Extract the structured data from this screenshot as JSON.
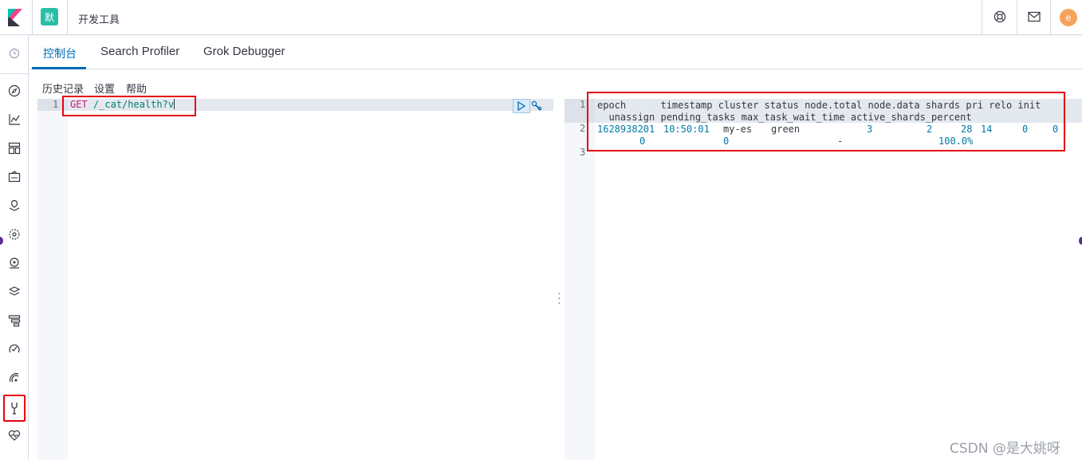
{
  "header": {
    "space_initial": "默",
    "breadcrumb": "开发工具",
    "user_initial": "e"
  },
  "tabs": [
    {
      "label": "控制台",
      "active": true
    },
    {
      "label": "Search Profiler",
      "active": false
    },
    {
      "label": "Grok Debugger",
      "active": false
    }
  ],
  "menu": {
    "history": "历史记录",
    "settings": "设置",
    "help": "帮助"
  },
  "request": {
    "line_number": "1",
    "method": "GET",
    "path": "/_cat/health?v"
  },
  "response": {
    "line_numbers": [
      "1",
      "2",
      "3"
    ],
    "header_line1": "epoch      timestamp cluster status node.total node.data shards pri relo init",
    "header_line2": "  unassign pending_tasks max_task_wait_time active_shards_percent",
    "row": {
      "epoch": "1628938201",
      "timestamp": "10:50:01",
      "cluster": "my-es",
      "status": "green",
      "node_total": "3",
      "node_data": "2",
      "shards": "28",
      "pri": "14",
      "relo": "0",
      "init": "0",
      "unassign": "0",
      "pending_tasks": "0",
      "max_task_wait_time": "-",
      "active_shards_percent": "100.0%"
    }
  },
  "watermark": "CSDN @是大姚呀",
  "colors": {
    "accent": "#006bb4",
    "highlight_box": "#e60012",
    "space_avatar": "#2bbea6",
    "user_avatar": "#f5a35c"
  }
}
